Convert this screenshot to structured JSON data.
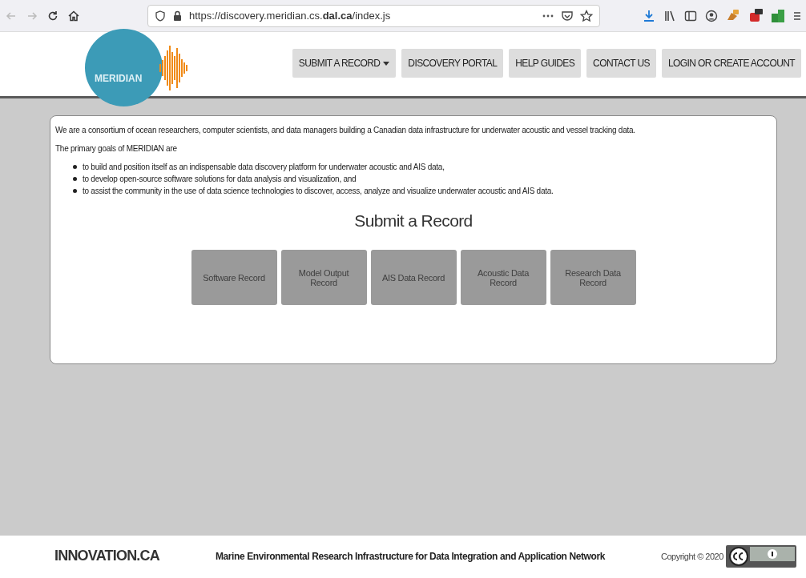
{
  "browser": {
    "url": "https://discovery.meridian.cs.**dal.ca**/index.js"
  },
  "header": {
    "logo_text": "MERIDIAN",
    "nav": [
      {
        "label": "SUBMIT A RECORD",
        "dropdown": true
      },
      {
        "label": "DISCOVERY PORTAL",
        "dropdown": false
      },
      {
        "label": "HELP GUIDES",
        "dropdown": false
      },
      {
        "label": "CONTACT US",
        "dropdown": false
      },
      {
        "label": "LOGIN OR CREATE ACCOUNT",
        "dropdown": false
      }
    ]
  },
  "intro": {
    "text": "We are a consortium of ocean researchers, computer scientists, and data managers building a Canadian data infrastructure for underwater acoustic and vessel tracking data.",
    "goals_lead": "The primary goals of MERIDIAN are",
    "goals": [
      "to build and position itself as an indispensable data discovery platform for underwater acoustic and AIS data,",
      "to develop open-source software solutions for data analysis and visualization, and",
      "to assist the community in the use of data science technologies to discover, access, analyze and visualize underwater acoustic and AIS data."
    ]
  },
  "submit": {
    "heading": "Submit a Record",
    "buttons": [
      {
        "label": "Software Record",
        "disabled": true
      },
      {
        "label": "Model Output Record",
        "disabled": true
      },
      {
        "label": "AIS Data Record",
        "disabled": true
      },
      {
        "label": "Acoustic Data Record",
        "disabled": true
      },
      {
        "label": "Research Data Record",
        "disabled": true
      }
    ]
  },
  "footer": {
    "funder": "INNOVATION.CA",
    "tagline": "Marine Environmental Research Infrastructure for Data Integration and Application Network",
    "copyright": "Copyright © 2020"
  }
}
